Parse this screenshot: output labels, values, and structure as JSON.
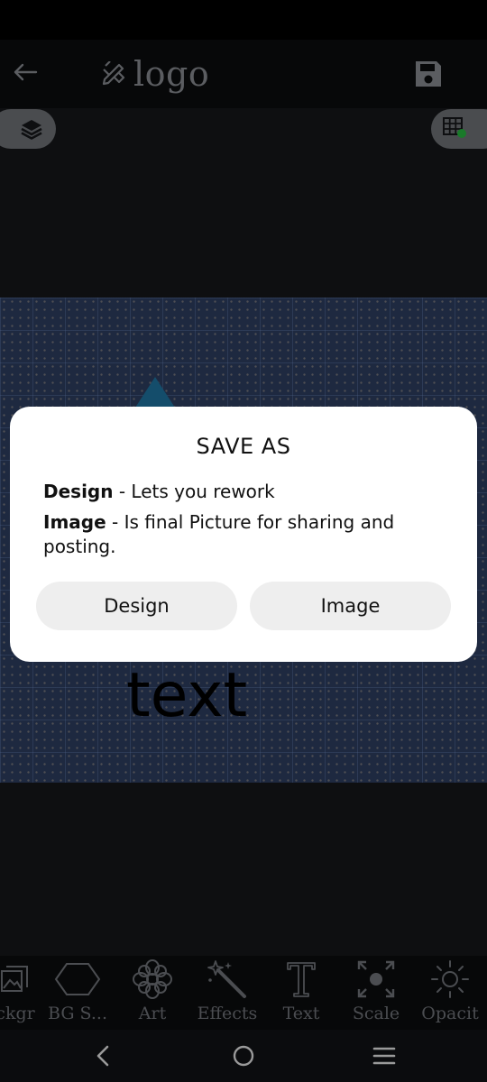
{
  "app_bar": {
    "title": "logo",
    "icons": {
      "back": "back-arrow-icon",
      "title": "edit-pencil-ruler-icon",
      "save": "save-floppy-icon"
    }
  },
  "canvas": {
    "text": "text"
  },
  "dialog": {
    "title": "SAVE AS",
    "design_term": "Design",
    "design_desc": " - Lets you rework",
    "image_term": "Image",
    "image_desc": " - Is final Picture for sharing and posting.",
    "design_button": "Design",
    "image_button": "Image"
  },
  "toolbar": {
    "items": [
      {
        "label": "ckgr",
        "icon": "image-stack-icon"
      },
      {
        "label": "BG S...",
        "icon": "hexagon-icon"
      },
      {
        "label": "Art",
        "icon": "flower-icon"
      },
      {
        "label": "Effects",
        "icon": "magic-wand-icon"
      },
      {
        "label": "Text",
        "icon": "text-icon"
      },
      {
        "label": "Scale",
        "icon": "scale-arrows-icon"
      },
      {
        "label": "Opacit",
        "icon": "sun-brightness-icon"
      }
    ]
  },
  "colors": {
    "accent_dot": "#1a7a2a",
    "icon_gray": "#5b5d61"
  }
}
